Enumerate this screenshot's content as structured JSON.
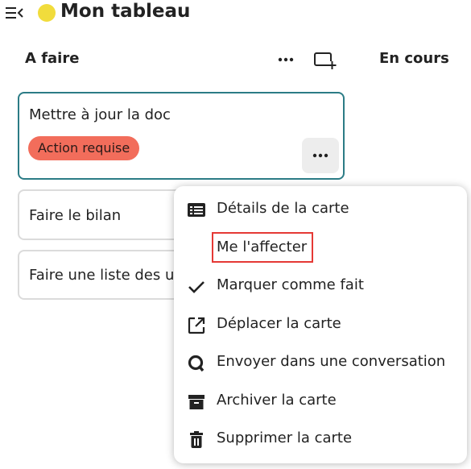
{
  "header": {
    "board_title": "Mon tableau",
    "board_color": "#f1dc3c",
    "menu_toggle_icon": "menu-collapse-icon"
  },
  "columns": [
    {
      "title": "A faire",
      "actions": [
        "more-icon",
        "add-card-icon"
      ]
    },
    {
      "title": "En cours"
    }
  ],
  "cards": [
    {
      "title": "Mettre à jour la doc",
      "labels": [
        {
          "text": "Action requise",
          "color": "#f26d5b"
        }
      ],
      "active": true,
      "more_icon": "more-horizontal-icon"
    },
    {
      "title": "Faire le bilan"
    },
    {
      "title": "Faire une liste des u"
    }
  ],
  "card_menu": {
    "items": [
      {
        "label": "Détails de la carte",
        "icon": "card-details-icon"
      },
      {
        "label": "Me l'affecter",
        "icon": "",
        "highlighted": true
      },
      {
        "label": "Marquer comme fait",
        "icon": "check-icon"
      },
      {
        "label": "Déplacer la carte",
        "icon": "open-in-new-icon"
      },
      {
        "label": "Envoyer dans une conversation",
        "icon": "talk-icon"
      },
      {
        "label": "Archiver la carte",
        "icon": "archive-icon"
      },
      {
        "label": "Supprimer la carte",
        "icon": "delete-icon"
      }
    ]
  },
  "colors": {
    "accent": "#2c7c86",
    "highlight": "#e53935",
    "text": "#222222"
  }
}
